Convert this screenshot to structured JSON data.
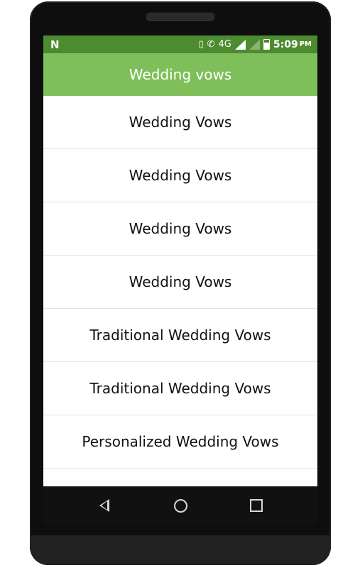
{
  "status_bar": {
    "left_glyph": "N",
    "network_label": "4G",
    "time": "5:09",
    "ampm": "PM",
    "icons": [
      "vibrate-icon",
      "wifi-call-icon",
      "signal-icon",
      "signal-dim-icon",
      "battery-icon"
    ]
  },
  "app_bar": {
    "title": "Wedding vows",
    "color": "#7ebf5a"
  },
  "list": {
    "items": [
      {
        "label": "Wedding Vows"
      },
      {
        "label": "Wedding Vows"
      },
      {
        "label": "Wedding Vows"
      },
      {
        "label": "Wedding Vows"
      },
      {
        "label": "Traditional Wedding Vows"
      },
      {
        "label": "Traditional Wedding Vows"
      },
      {
        "label": "Personalized Wedding Vows"
      }
    ]
  },
  "nav_bar": {
    "back_icon": "back-triangle-icon",
    "home_icon": "home-circle-icon",
    "recent_icon": "recent-square-icon"
  },
  "colors": {
    "status_bar": "#4d8b31",
    "app_bar": "#7ebf5a",
    "divider": "#d7ecd0"
  }
}
